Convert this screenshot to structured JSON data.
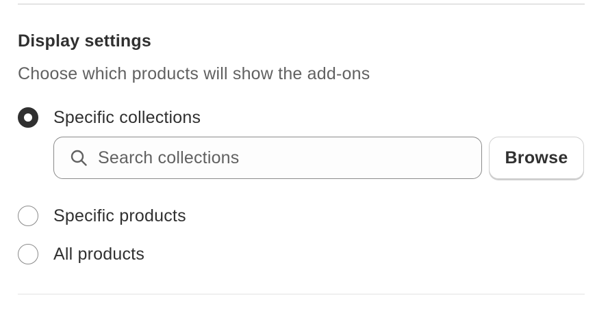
{
  "section": {
    "title": "Display settings",
    "description": "Choose which products will show the add-ons"
  },
  "options": {
    "collections": {
      "label": "Specific collections",
      "checked": true
    },
    "products": {
      "label": "Specific products",
      "checked": false
    },
    "all": {
      "label": "All products",
      "checked": false
    }
  },
  "search": {
    "icon": "search-icon",
    "placeholder": "Search collections",
    "value": ""
  },
  "browse": {
    "label": "Browse"
  },
  "colors": {
    "text": "#303030",
    "secondary_text": "#616161",
    "border": "#8a8a8a",
    "divider": "#e3e3e3"
  }
}
